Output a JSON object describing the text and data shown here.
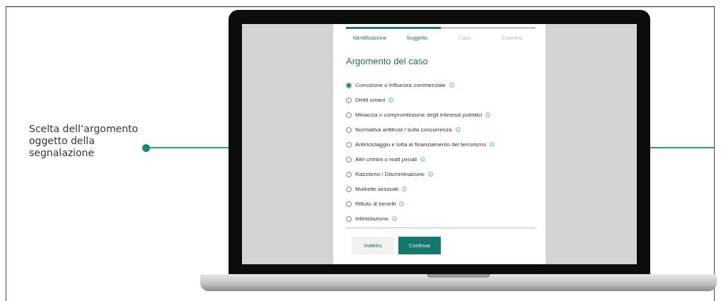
{
  "callout": {
    "text": "Scelta dell’argomento oggetto della segnalazione"
  },
  "screen": {
    "progress": {
      "level": 0.5
    },
    "steps": [
      {
        "label": "Identificazione",
        "done": true
      },
      {
        "label": "Soggetto",
        "done": true
      },
      {
        "label": "Caso",
        "done": false
      },
      {
        "label": "Esamina",
        "done": false
      }
    ],
    "title": "Argomento del caso",
    "options": [
      {
        "label": "Corruzione o influenza commerciale",
        "selected": true
      },
      {
        "label": "Diritti umani",
        "selected": false
      },
      {
        "label": "Minaccia o compromissione degli interessi pubblici",
        "selected": false
      },
      {
        "label": "Normativa antitrust / sulla concorrenza",
        "selected": false
      },
      {
        "label": "Antiriciclaggio e lotta al finanziamento del terrorismo",
        "selected": false
      },
      {
        "label": "Altri crimini o reati penali",
        "selected": false
      },
      {
        "label": "Razzismo / Discriminazione",
        "selected": false
      },
      {
        "label": "Molestie sessuali",
        "selected": false
      },
      {
        "label": "Rifiuto di benefit",
        "selected": false
      },
      {
        "label": "Intimidazione",
        "selected": false
      }
    ],
    "buttons": [
      {
        "label": "Indietro",
        "kind": "secondary"
      },
      {
        "label": "Continua",
        "kind": "primary"
      }
    ]
  }
}
